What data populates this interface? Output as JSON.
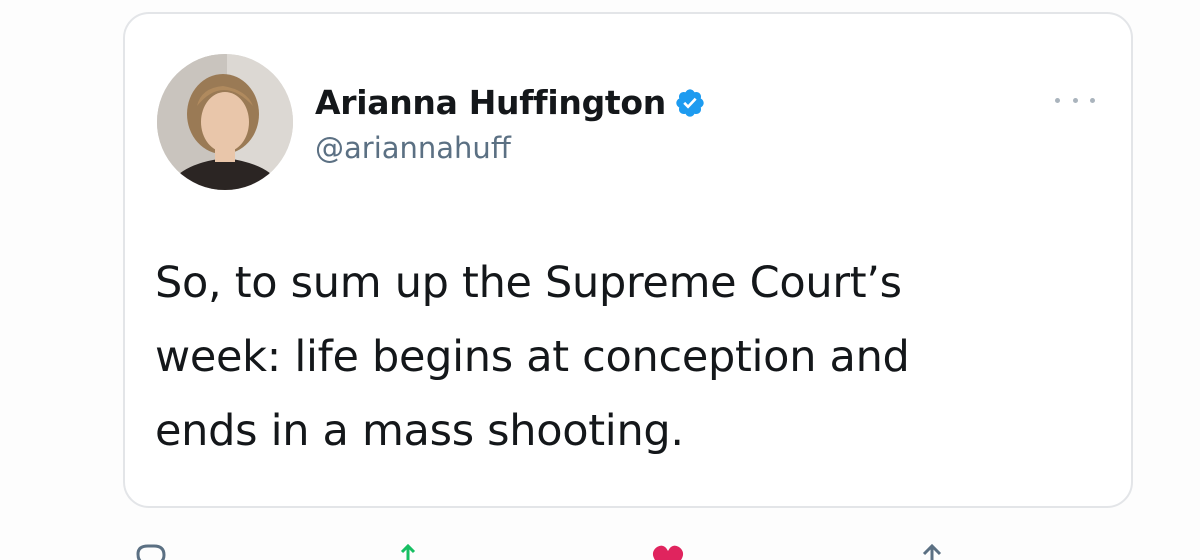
{
  "tweet": {
    "author": {
      "display_name": "Arianna Huffington",
      "handle": "@ariannahuff",
      "verified": true
    },
    "text": "So, to sum up the Supreme Court’s\nweek: life begins at conception and\nends in a mass shooting."
  },
  "icons": {
    "verified": "verified-badge-icon",
    "more": "more-options-icon",
    "reply": "reply-icon",
    "retweet": "retweet-icon",
    "like": "like-icon",
    "share": "share-icon"
  },
  "colors": {
    "text": "#14171a",
    "handle": "#5b7083",
    "verified": "#1d9bf0",
    "card_border": "#e3e5e8",
    "like": "#e0245e"
  }
}
